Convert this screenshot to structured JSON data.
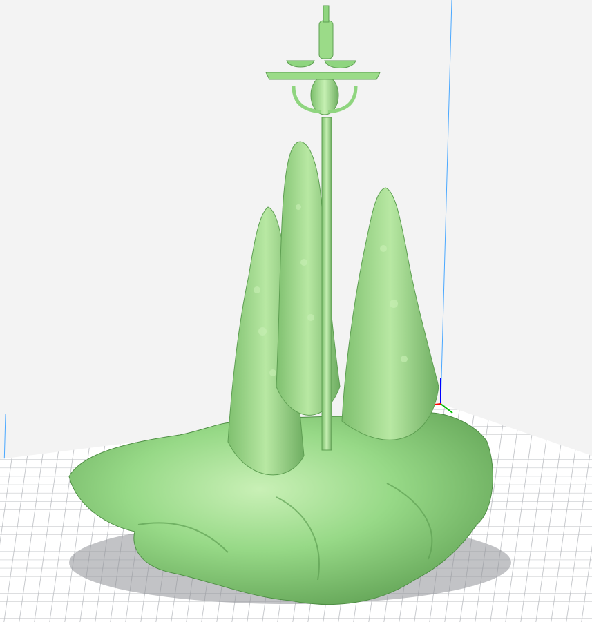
{
  "viewport": {
    "background": "#f3f3f3",
    "build_plate_color": "#ffffff",
    "grid_color": "#b9bcc0",
    "model_color": "#8fd57f",
    "model_highlight": "#c9f0b6",
    "model_shadow": "#5e9f52",
    "axis_x_color": "#ff0000",
    "axis_y_color": "#00c000",
    "axis_z_color": "#0000ff",
    "volume_edge_color": "#4aa8ff"
  },
  "model": {
    "name_icon": "stalagmite-lamp-model"
  }
}
